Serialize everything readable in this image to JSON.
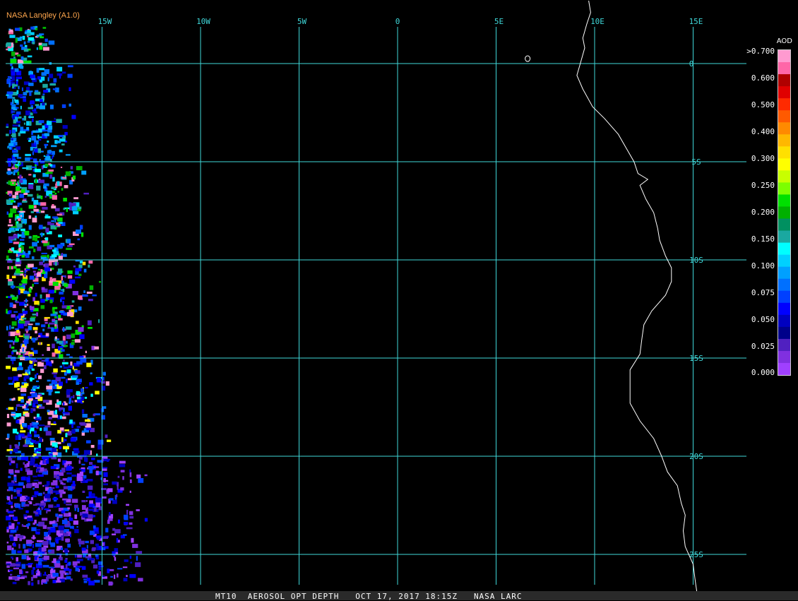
{
  "credit": "NASA Langley (A1.0)",
  "footer": {
    "product": "MT10",
    "parameter": "AEROSOL OPT DEPTH",
    "datetime": "OCT 17, 2017 18:15Z",
    "source": "NASA LARC"
  },
  "grid": {
    "longitudes": [
      {
        "value": -15,
        "label": "15W"
      },
      {
        "value": -10,
        "label": "10W"
      },
      {
        "value": -5,
        "label": "5W"
      },
      {
        "value": 0,
        "label": "0"
      },
      {
        "value": 5,
        "label": "5E"
      },
      {
        "value": 10,
        "label": "10E"
      },
      {
        "value": 15,
        "label": "15E"
      }
    ],
    "latitudes": [
      {
        "value": 0,
        "label": "0"
      },
      {
        "value": -5,
        "label": "5S"
      },
      {
        "value": -10,
        "label": "10S"
      },
      {
        "value": -15,
        "label": "15S"
      },
      {
        "value": -20,
        "label": "20S"
      },
      {
        "value": -25,
        "label": "25S"
      }
    ],
    "line_color": "#3fd7d9"
  },
  "colorbar": {
    "title": "AOD",
    "labels": [
      ">0.700",
      "0.600",
      "0.500",
      "0.400",
      "0.300",
      "0.250",
      "0.200",
      "0.150",
      "0.100",
      "0.075",
      "0.050",
      "0.025",
      "0.000"
    ],
    "colors": [
      "#ff9ad0",
      "#ff66a8",
      "#b00000",
      "#e00000",
      "#ff2a00",
      "#ff5a00",
      "#ff8a00",
      "#ffb800",
      "#ffe000",
      "#ffff00",
      "#c8ff00",
      "#7cff00",
      "#00e000",
      "#00b000",
      "#009060",
      "#1aa8a0",
      "#00ffff",
      "#00d0ff",
      "#00a0ff",
      "#0070ff",
      "#0040ff",
      "#0000ff",
      "#0000c0",
      "#00008a",
      "#5020c0",
      "#8030e0",
      "#a040ff"
    ]
  },
  "legend_icon": "colorbar-scale",
  "coastline_color": "#ffffff"
}
